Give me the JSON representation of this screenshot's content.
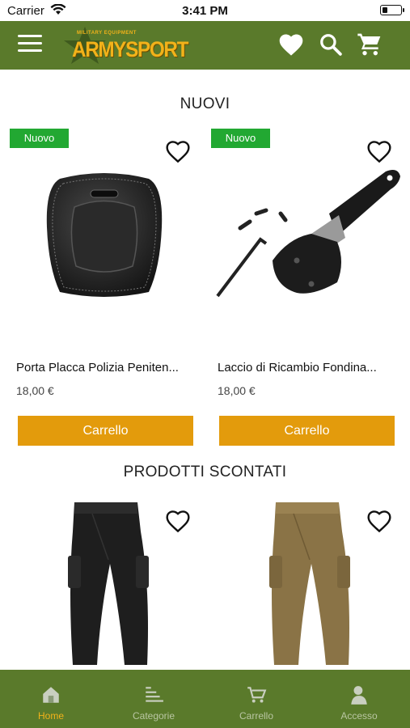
{
  "status_bar": {
    "carrier": "Carrier",
    "time": "3:41 PM",
    "battery_level": 0.3
  },
  "header": {
    "logo_text": "ARMYSPORT",
    "logo_small_text": "MILITARY EQUIPMENT",
    "menu_icon": "hamburger-menu-icon",
    "icons": [
      "heart-icon",
      "search-icon",
      "cart-icon"
    ]
  },
  "sections": {
    "new": {
      "title": "NUOVI"
    },
    "discounted": {
      "title": "PRODOTTI SCONTATI"
    }
  },
  "new_products": [
    {
      "badge": "Nuovo",
      "name": "Porta Placca Polizia Peniten...",
      "price": "18,00 €",
      "button": "Carrello",
      "image": "badge-holder"
    },
    {
      "badge": "Nuovo",
      "name": "Laccio di Ricambio Fondina...",
      "price": "18,00 €",
      "button": "Carrello",
      "image": "holster-strap"
    }
  ],
  "discounted_products": [
    {
      "image": "black-pants"
    },
    {
      "image": "coyote-pants"
    }
  ],
  "tabs": [
    {
      "label": "Home",
      "icon": "home-icon",
      "active": true
    },
    {
      "label": "Categorie",
      "icon": "categories-icon",
      "active": false
    },
    {
      "label": "Carrello",
      "icon": "cart-icon",
      "active": false
    },
    {
      "label": "Accesso",
      "icon": "user-icon",
      "active": false
    }
  ],
  "colors": {
    "header_green": "#5a7a2b",
    "badge_green": "#22a832",
    "button_orange": "#e39b0c",
    "active_tab": "#f2b21a"
  }
}
